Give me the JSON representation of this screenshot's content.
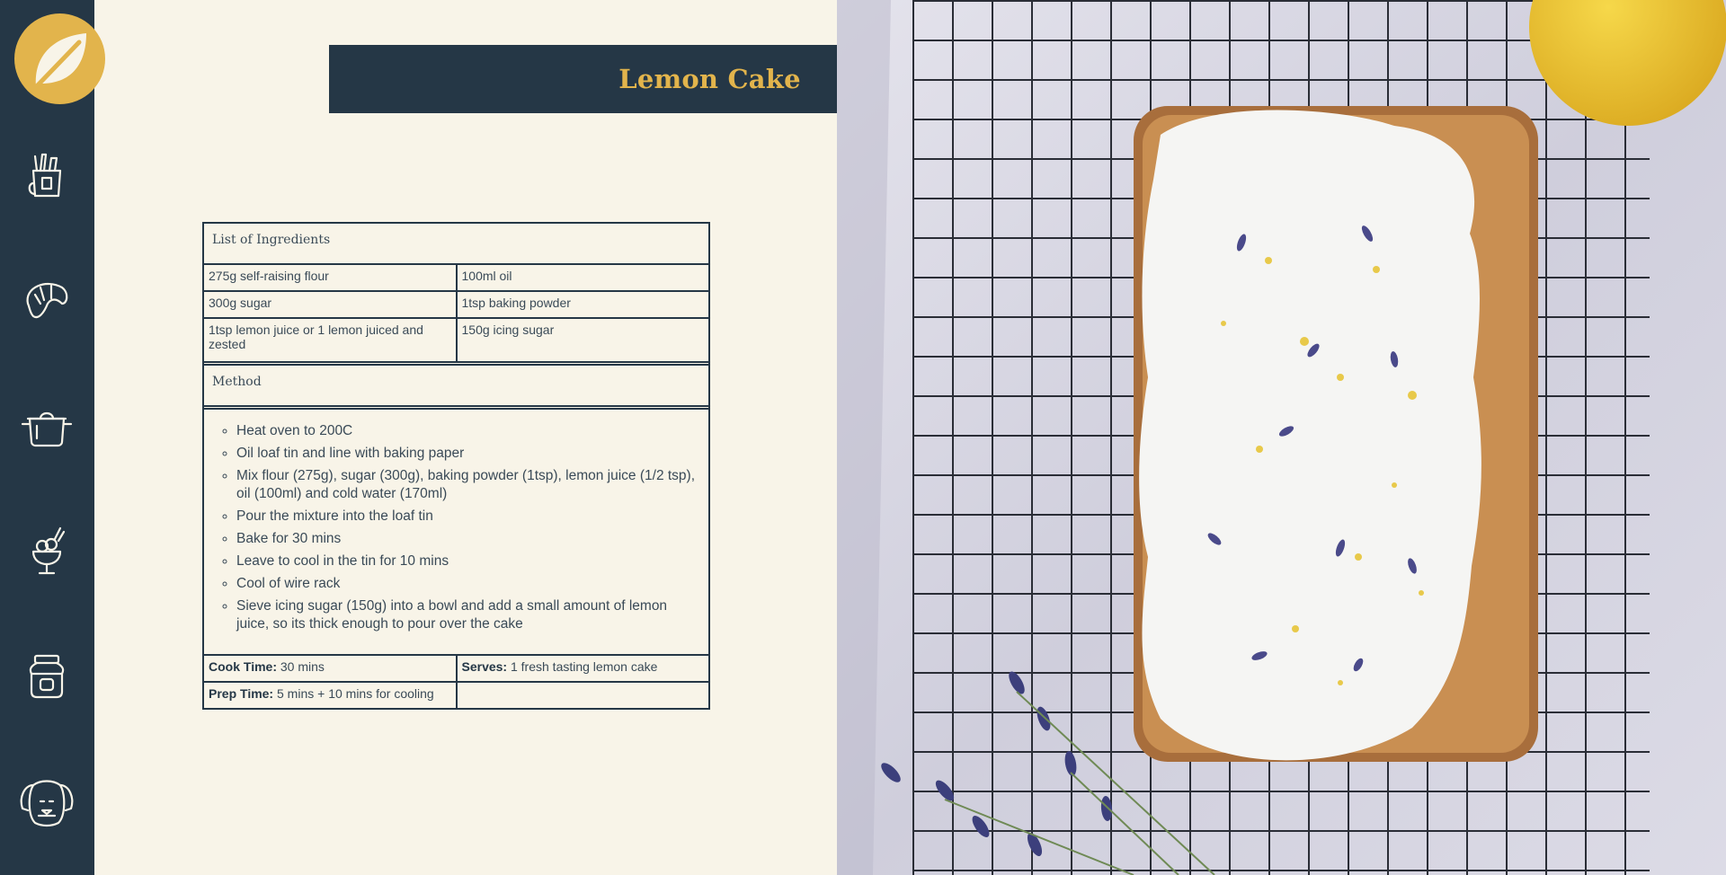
{
  "sidebar": {
    "logo_icon": "leaf-icon",
    "items": [
      {
        "icon": "groceries-icon"
      },
      {
        "icon": "croissant-icon"
      },
      {
        "icon": "cooking-pot-icon"
      },
      {
        "icon": "ice-cream-sundae-icon"
      },
      {
        "icon": "jar-icon"
      },
      {
        "icon": "dog-face-icon"
      }
    ]
  },
  "recipe": {
    "title": "Lemon Cake",
    "ingredients_heading": "List of Ingredients",
    "ingredients": [
      [
        "275g self-raising flour",
        "100ml oil"
      ],
      [
        "300g sugar",
        "1tsp baking powder"
      ],
      [
        "1tsp lemon juice or 1 lemon juiced and zested",
        "150g icing sugar"
      ]
    ],
    "method_heading": "Method",
    "method": [
      "Heat oven to 200C",
      "Oil loaf tin and line with baking paper",
      "Mix flour (275g), sugar (300g), baking powder (1tsp), lemon juice (1/2 tsp), oil (100ml) and cold water (170ml)",
      "Pour the mixture into the loaf tin",
      "Bake for 30 mins",
      "Leave to cool in the tin for 10 mins",
      "Cool of wire rack",
      "Sieve icing sugar (150g) into a bowl and add a small amount of lemon juice, so its thick enough to pour over the cake"
    ],
    "cook_time_label": "Cook Time:",
    "cook_time": "30 mins",
    "serves_label": "Serves:",
    "serves": "1 fresh tasting lemon cake",
    "prep_time_label": "Prep Time:",
    "prep_time": "5 mins + 10 mins for cooling"
  },
  "colors": {
    "navy": "#253746",
    "gold": "#e2b44c",
    "cream": "#f8f4e8"
  }
}
